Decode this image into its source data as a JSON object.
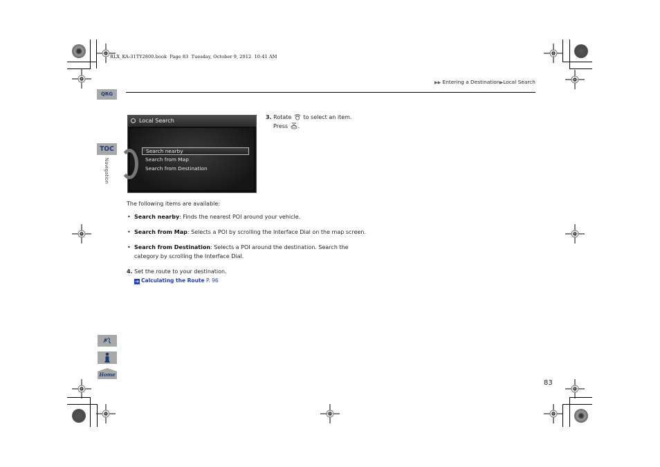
{
  "file_header": "RLX_KA-31TY2800.book  Page 83  Tuesday, October 9, 2012  10:41 AM",
  "breadcrumb": {
    "items": [
      "Entering a Destination",
      "Local Search"
    ]
  },
  "side_tabs": {
    "qrg": "QRG",
    "toc": "TOC",
    "section": "Navigation"
  },
  "screen": {
    "title": "Local Search",
    "items": [
      {
        "label": "Search nearby",
        "selected": true
      },
      {
        "label": "Search from Map",
        "selected": false
      },
      {
        "label": "Search from Destination",
        "selected": false
      }
    ]
  },
  "step3": {
    "number": "3.",
    "line1_before": "Rotate",
    "line1_after": "to select an item.",
    "line2_before": "Press",
    "line2_after": "."
  },
  "intro": "The following items are available:",
  "bullets": [
    {
      "term": "Search nearby",
      "desc": ": Finds the nearest POI around your vehicle."
    },
    {
      "term": "Search from Map",
      "desc": ": Selects a POI by scrolling the Interface Dial on the map screen."
    },
    {
      "term": "Search from Destination",
      "desc": ": Selects a POI around the destination. Search the category by scrolling the Interface Dial."
    }
  ],
  "step4": {
    "number": "4.",
    "text": "Set the route to your destination."
  },
  "xref": {
    "link": "Calculating the Route",
    "page": "P. 96"
  },
  "bottom_icons": [
    "voice-command-icon",
    "info-icon",
    "home-icon"
  ],
  "bottom_icon_labels": {
    "home": "Home"
  },
  "page_number": "83",
  "colors": {
    "tab_bg": "#a7a9a8",
    "tab_text": "#1a3a74",
    "link": "#1e3bd6"
  }
}
